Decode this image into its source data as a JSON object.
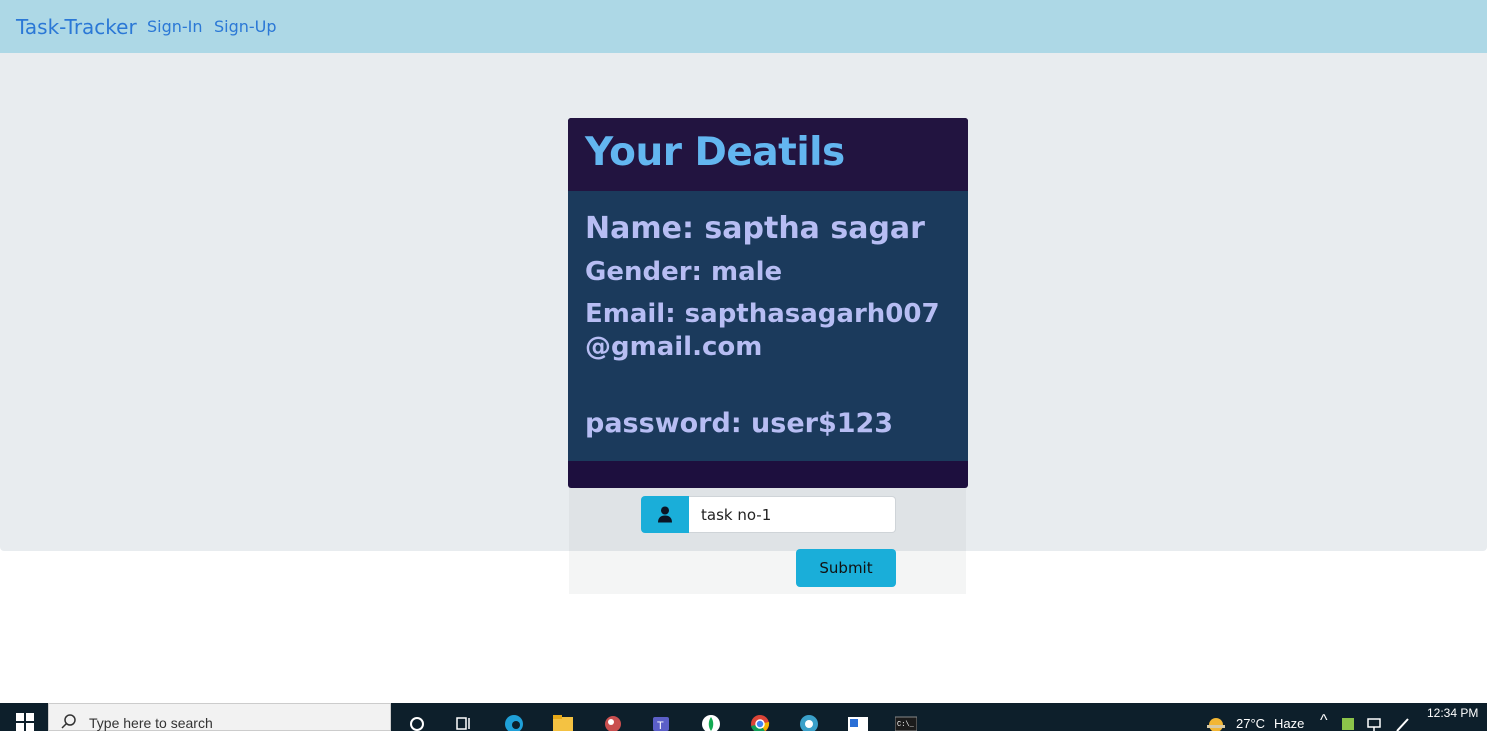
{
  "navbar": {
    "brand": "Task-Tracker",
    "links": [
      "Sign-In",
      "Sign-Up"
    ]
  },
  "card": {
    "title": "Your Deatils",
    "name": "Name: saptha sagar",
    "gender": "Gender: male",
    "email": "Email: sapthasagarh007@gmail.com",
    "password": "password: user$123"
  },
  "form": {
    "task_value": "task no-1",
    "submit_label": "Submit",
    "input_icon": "user-icon"
  },
  "taskbar": {
    "search_placeholder": "Type here to search",
    "weather_temp": "27°C",
    "weather_desc": "Haze",
    "time": "12:34 PM"
  },
  "colors": {
    "navbar": "#add8e6",
    "link": "#2b78d6",
    "card_header": "#221440",
    "card_body": "#1b3a5c",
    "card_title": "#63b6f0",
    "card_text": "#b7bdf3",
    "accent": "#1aaed9"
  }
}
